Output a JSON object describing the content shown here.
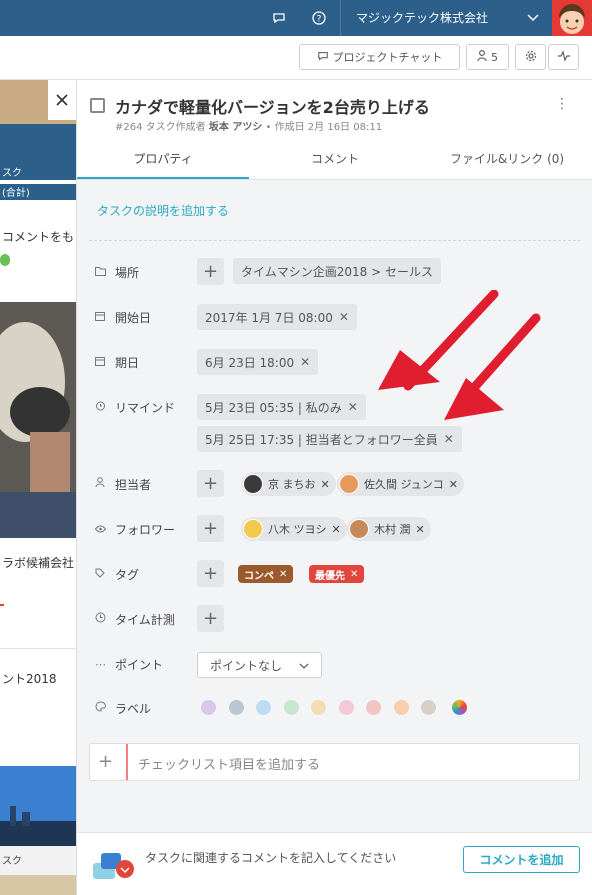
{
  "topbar": {
    "company": "マジックテック株式会社",
    "icons": [
      "chat-bubble-icon",
      "help-icon",
      "chevron-down-icon"
    ],
    "colors": {
      "bar": "#2c5f8a",
      "avatar_bg": "#e53935"
    }
  },
  "toolbar": {
    "project_chat_label": "プロジェクトチャット",
    "member_count": "5"
  },
  "background": {
    "texts": [
      "スク",
      "(合計)",
      "コメントをも",
      "ラボ候補会社",
      "ント2018",
      "スク"
    ]
  },
  "task": {
    "title": "カナダで軽量化バージョンを2台売り上げる",
    "id": "#264",
    "meta_prefix": "タスク作成者",
    "author": "坂本 アツシ",
    "created": "作成日 2月 16日 08:11"
  },
  "tabs": [
    "プロパティ",
    "コメント",
    "ファイル&リンク (0)"
  ],
  "description_link": "タスクの説明を追加する",
  "properties": {
    "location": {
      "label": "場所",
      "value": "タイムマシン企画2018 > セールス"
    },
    "start": {
      "label": "開始日",
      "value": "2017年 1月 7日 08:00"
    },
    "due": {
      "label": "期日",
      "value": "6月 23日 18:00"
    },
    "remind": {
      "label": "リマインド",
      "values": [
        "5月 23日 05:35 | 私のみ",
        "5月 25日 17:35 | 担当者とフォロワー全員"
      ]
    },
    "assignee": {
      "label": "担当者",
      "people": [
        "京 まちお",
        "佐久間 ジュンコ"
      ]
    },
    "follower": {
      "label": "フォロワー",
      "people": [
        "八木 ツヨシ",
        "木村 潤"
      ]
    },
    "tag": {
      "label": "タグ",
      "tags": [
        {
          "name": "コンペ",
          "color": "#9c5a2c"
        },
        {
          "name": "最優先",
          "color": "#e0463c"
        }
      ]
    },
    "timer": {
      "label": "タイム計測"
    },
    "point": {
      "label": "ポイント",
      "value": "ポイントなし"
    },
    "labels": {
      "label": "ラベル",
      "colors": [
        "#d9c7ea",
        "#b9c7d6",
        "#bcdcf2",
        "#c7e6cd",
        "#f5dbb0",
        "#f5c8d8",
        "#f2c4c4",
        "#f5cfae",
        "#d8cfc6"
      ]
    }
  },
  "checklist_placeholder": "チェックリスト項目を追加する",
  "footer": {
    "prompt": "タスクに関連するコメントを記入してください",
    "button": "コメントを追加"
  }
}
